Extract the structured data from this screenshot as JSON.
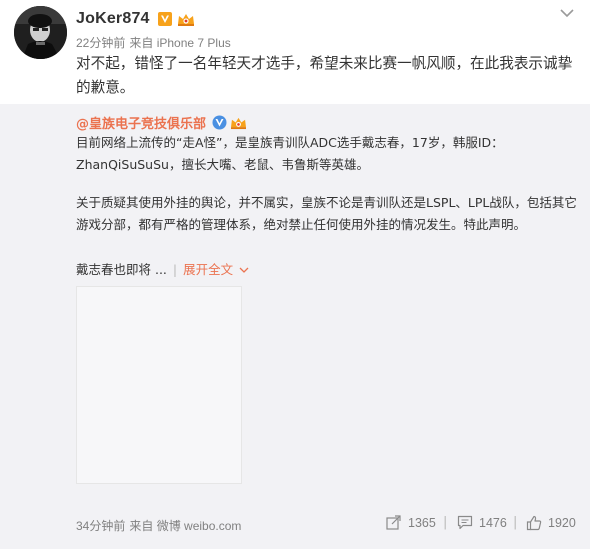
{
  "post": {
    "author": "JoKer874",
    "timestamp": "22分钟前",
    "source": "来自 iPhone 7 Plus",
    "text": "对不起，错怪了一名年轻天才选手，希望未来比赛一帆风顺，在此我表示诚挚的歉意。"
  },
  "repost": {
    "author": "@皇族电子竞技俱乐部",
    "paragraph1": "目前网络上流传的“走A怪”，是皇族青训队ADC选手戴志春，17岁，韩服ID：ZhanQiSuSuSu，擅长大嘴、老鼠、韦鲁斯等英雄。",
    "paragraph2": "关于质疑其使用外挂的舆论，并不属实，皇族不论是青训队还是LSPL、LPL战队，包括其它游戏分部，都有严格的管理体系，绝对禁止任何使用外挂的情况发生。特此声明。",
    "paragraph3": "戴志春也即将 ...",
    "expand_label": "展开全文",
    "timestamp": "34分钟前",
    "source": "来自 微博 weibo.com",
    "share_count": "1365",
    "comment_count": "1476",
    "like_count": "1920"
  },
  "colors": {
    "accent": "#eb7350",
    "verified_badge": "#f7a21b",
    "repost_bg": "#f2f2f5"
  },
  "icons": {
    "v_badge": "verified-v-icon",
    "vip": "vip-crown-icon",
    "share": "share-icon",
    "comment": "comment-icon",
    "like": "thumbs-up-icon",
    "menu": "chevron-down-icon"
  }
}
